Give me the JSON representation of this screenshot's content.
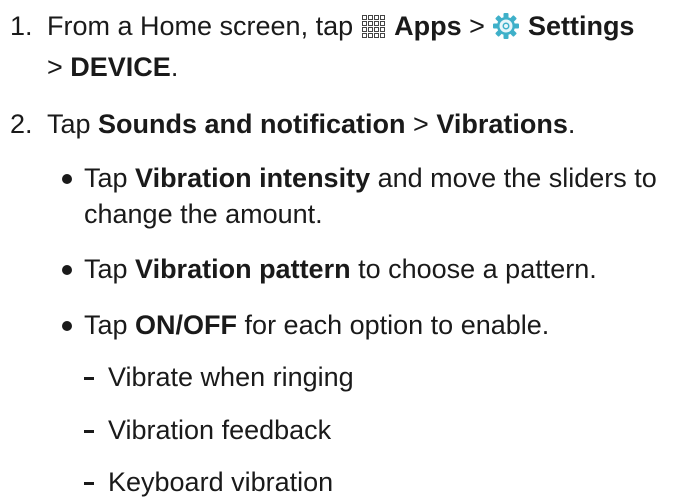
{
  "steps": [
    {
      "number": "1.",
      "text_pre": "From a Home screen, tap ",
      "apps_icon": "apps-grid-icon",
      "apps_label": "Apps",
      "sep1": " > ",
      "settings_icon": "settings-gear-icon",
      "settings_label": "Settings",
      "sep2": "> ",
      "device_label": "DEVICE",
      "end": "."
    },
    {
      "number": "2.",
      "text_pre": "Tap ",
      "sounds_label": "Sounds and notification",
      "sep": " > ",
      "vibrations_label": "Vibrations",
      "end": "."
    }
  ],
  "bullets": [
    {
      "pre": "Tap ",
      "bold": "Vibration intensity",
      "post": " and move the sliders to change the amount."
    },
    {
      "pre": "Tap ",
      "bold": "Vibration pattern",
      "post": " to choose a pattern."
    },
    {
      "pre": "Tap ",
      "bold": "ON/OFF",
      "post": " for each option to enable."
    }
  ],
  "sub_items": [
    "Vibrate when ringing",
    "Vibration feedback",
    "Keyboard vibration"
  ],
  "colors": {
    "text": "#1a1a1a",
    "settings_icon_ring": "#3fb0c9",
    "settings_icon_center": "#e8f6fa"
  }
}
